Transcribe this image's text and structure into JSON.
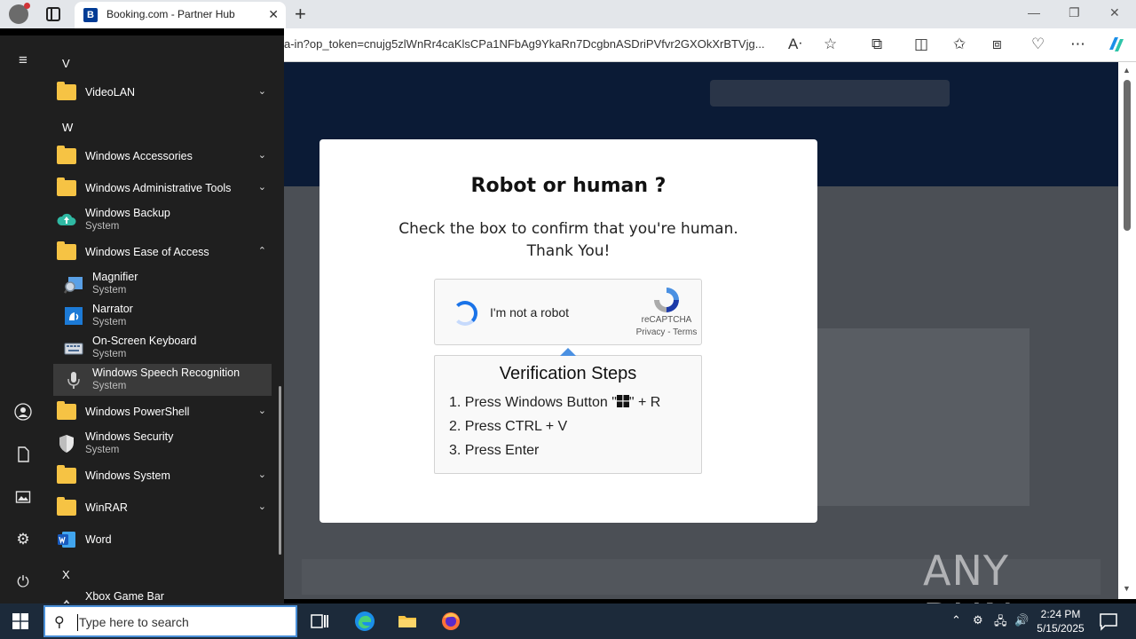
{
  "browser": {
    "tab_title": "Booking.com - Partner Hub",
    "tab_favicon": "B",
    "url": "a-in?op_token=cnujg5zlWnRr4caKlsCPa1NFbAg9YkaRn7DcgbnASDriPVfvr2GXOkXrBTVjg..."
  },
  "captcha": {
    "title": "Robot or human ?",
    "message_line1": "Check the box to confirm that you're human.",
    "message_line2": "Thank You!",
    "checkbox_label": "I'm not a robot",
    "brand": "reCAPTCHA",
    "privacy": "Privacy",
    "separator": " - ",
    "terms": "Terms",
    "steps_title": "Verification Steps",
    "step1_pre": "1. Press Windows Button \"",
    "step1_post": "\" + R",
    "step2": "2. Press CTRL + V",
    "step3": "3. Press Enter"
  },
  "startmenu": {
    "letters": {
      "v": "V",
      "w": "W",
      "x": "X"
    },
    "apps": {
      "videolan": {
        "name": "VideoLAN"
      },
      "accessories": {
        "name": "Windows Accessories"
      },
      "admin_tools": {
        "name": "Windows Administrative Tools"
      },
      "backup": {
        "name": "Windows Backup",
        "sub": "System"
      },
      "ease": {
        "name": "Windows Ease of Access"
      },
      "magnifier": {
        "name": "Magnifier",
        "sub": "System"
      },
      "narrator": {
        "name": "Narrator",
        "sub": "System"
      },
      "osk": {
        "name": "On-Screen Keyboard",
        "sub": "System"
      },
      "speech": {
        "name": "Windows Speech Recognition",
        "sub": "System"
      },
      "powershell": {
        "name": "Windows PowerShell"
      },
      "security": {
        "name": "Windows Security",
        "sub": "System"
      },
      "system": {
        "name": "Windows System"
      },
      "winrar": {
        "name": "WinRAR"
      },
      "word": {
        "name": "Word"
      },
      "xbox": {
        "name": "Xbox Game Bar"
      }
    }
  },
  "taskbar": {
    "search_placeholder": "Type here to search",
    "time": "2:24 PM",
    "date": "5/15/2025"
  },
  "watermark": {
    "text": "ANY RUN"
  },
  "colors": {
    "accent": "#1a73e8",
    "folder": "#f6c344",
    "taskbar": "#1c2a3a",
    "menu_bg": "#1f1f1f"
  }
}
